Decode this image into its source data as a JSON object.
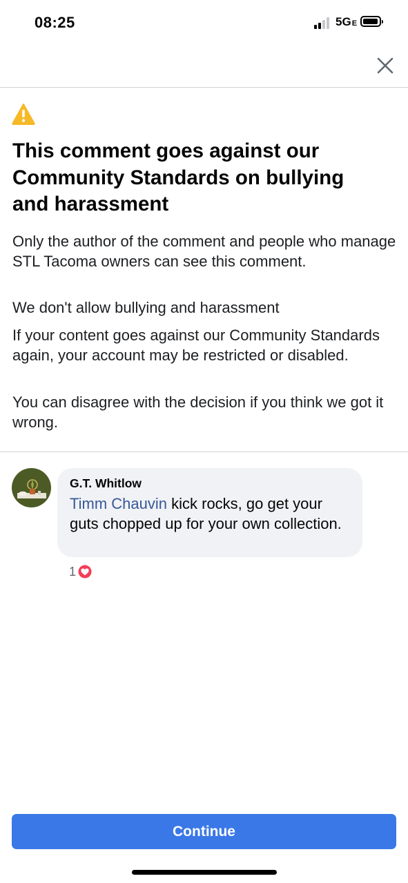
{
  "status_bar": {
    "time": "08:25",
    "network": "5G",
    "network_suffix": "E",
    "icons": [
      "signal-icon",
      "battery-icon"
    ]
  },
  "header": {
    "close_icon": "close-icon"
  },
  "notice": {
    "icon": "warning-icon",
    "title": "This comment goes against our Community Standards on bullying and harassment",
    "paragraphs": [
      "Only the author of the comment and people who manage STL Tacoma owners can see this comment.",
      "We don't allow bullying and harassment",
      "If your content goes against our Community Standards again, your account may be restricted or disabled.",
      "You can disagree with the decision if you think we got it wrong."
    ]
  },
  "comment": {
    "author": "G.T. Whitlow",
    "mention": "Timm Chauvin",
    "text": " kick rocks, go get your guts chopped up for your own collection.",
    "reaction_count": "1",
    "reaction_icon": "heart-reaction-icon"
  },
  "footer": {
    "continue_label": "Continue"
  },
  "colors": {
    "accent": "#3a78e7",
    "mention": "#385898",
    "warning": "#f7b928",
    "reaction": "#f33e58",
    "bubble": "#f0f2f5"
  }
}
